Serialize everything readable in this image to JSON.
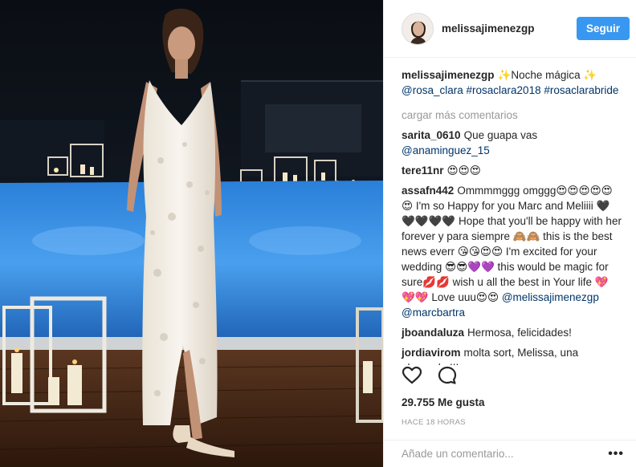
{
  "header": {
    "username": "melissajimenezgp",
    "follow_label": "Seguir"
  },
  "caption": {
    "username": "melissajimenezgp",
    "text": "✨Noche mágica ✨",
    "tags": [
      "@rosa_clara",
      "#rosaclara2018",
      "#rosaclarabride"
    ]
  },
  "load_more_label": "cargar más comentarios",
  "comments": [
    {
      "user": "sarita_0610",
      "text": "Que guapa vas ",
      "mention": "@anaminguez_15",
      "tail": ""
    },
    {
      "user": "tere11nr",
      "text": "😍😍😍",
      "mention": "",
      "tail": ""
    },
    {
      "user": "assafn442",
      "text": "Ommmmggg omggg😍😍😍😍😍😍 I'm so Happy for you Marc and Meliiii 🖤🖤🖤🖤🖤 Hope that you'll be happy with her forever y para siempre 🙈🙈 this is the best news everr 😘😘😍😍 I'm excited for your wedding 😎😎💜💜 this would be magic for sure💋💋 wish u all the best in Your life 💖💖💖 Love uuu😍😍 ",
      "mention": "@melissajimenezgp",
      "tail": " ",
      "mention2": "@marcbartra"
    },
    {
      "user": "jboandaluza",
      "text": "Hermosa, felicidades!",
      "mention": "",
      "tail": ""
    },
    {
      "user": "jordiavirom",
      "text": "molta sort, Melissa, una abraçada !!!",
      "mention": "",
      "tail": ""
    }
  ],
  "likes": "29.755 Me gusta",
  "timestamp": "HACE 18 HORAS",
  "add_comment": {
    "placeholder": "Añade un comentario...",
    "more": "•••"
  }
}
